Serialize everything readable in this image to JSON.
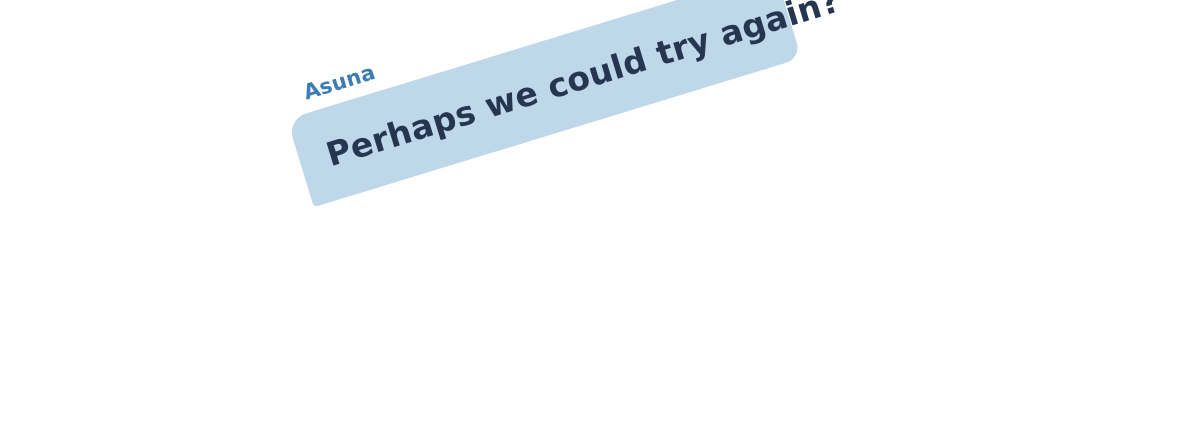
{
  "message": {
    "speaker": "Asuna",
    "text": "Perhaps we could try again?"
  },
  "colors": {
    "speaker": "#3d7cb4",
    "bubble": "#bed8ea",
    "text": "#263650"
  }
}
